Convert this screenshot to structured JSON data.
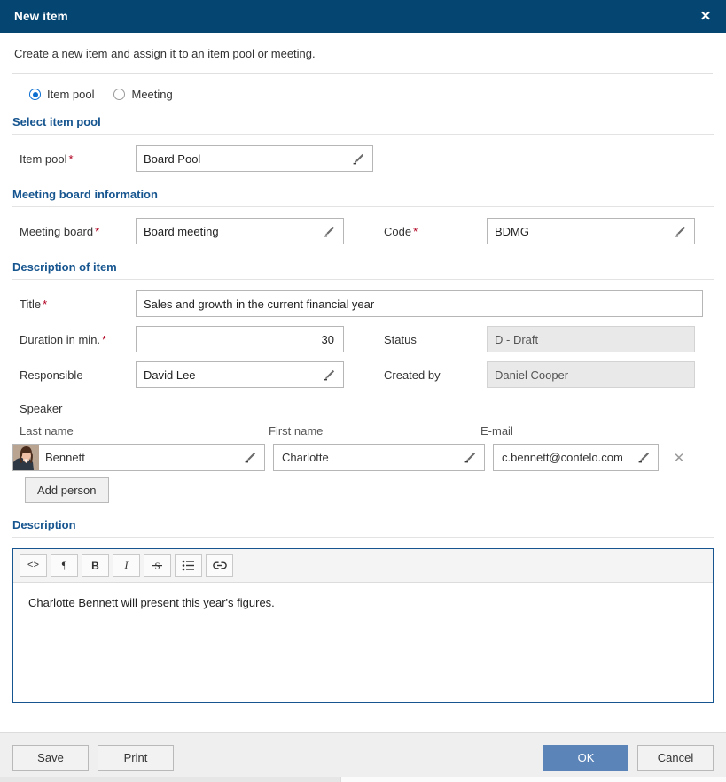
{
  "titlebar": {
    "title": "New item",
    "close_icon": "close-icon",
    "close_glyph": "✕",
    "background": "#054571"
  },
  "subtitle": "Create a new item and assign it to an item pool or meeting.",
  "assignment": {
    "options": [
      {
        "label": "Item pool",
        "selected": true
      },
      {
        "label": "Meeting",
        "selected": false
      }
    ],
    "accent": "#0a6ed1"
  },
  "sections": {
    "select_item_pool": {
      "heading": "Select item pool",
      "fields": {
        "item_pool": {
          "label": "Item pool",
          "required_marker": "*",
          "value": "Board Pool",
          "icon": "pencil-icon"
        }
      }
    },
    "meeting_board_information": {
      "heading": "Meeting board information",
      "fields": {
        "meeting_board": {
          "label": "Meeting board",
          "required_marker": "*",
          "value": "Board meeting",
          "icon": "pencil-icon"
        },
        "code": {
          "label": "Code",
          "required_marker": "*",
          "value": "BDMG",
          "icon": "pencil-icon"
        }
      }
    },
    "description_of_item": {
      "heading": "Description of item",
      "fields": {
        "title": {
          "label": "Title",
          "required_marker": "*",
          "value": "Sales and growth in the current financial year"
        },
        "duration": {
          "label": "Duration in min.",
          "required_marker": "*",
          "value": "30"
        },
        "status": {
          "label": "Status",
          "value": "D - Draft",
          "readonly": true
        },
        "responsible": {
          "label": "Responsible",
          "value": "David Lee",
          "icon": "pencil-icon"
        },
        "created_by": {
          "label": "Created by",
          "value": "Daniel Cooper",
          "readonly": true
        }
      }
    },
    "speaker": {
      "heading": "Speaker",
      "columns": {
        "last_name": "Last name",
        "first_name": "First name",
        "email": "E-mail"
      },
      "rows": [
        {
          "avatar": "person-photo-avatar",
          "last_name": "Bennett",
          "first_name": "Charlotte",
          "email": "c.bennett@contelo.com",
          "delete_glyph": "✕"
        }
      ],
      "add_person_label": "Add person"
    },
    "description": {
      "heading": "Description",
      "toolbar": [
        {
          "name": "source-code-icon",
          "glyph": "<>",
          "title": "Source code"
        },
        {
          "name": "paragraph-icon",
          "glyph": "¶",
          "title": "Paragraph"
        },
        {
          "name": "bold-icon",
          "glyph": "B",
          "title": "Bold"
        },
        {
          "name": "italic-icon",
          "glyph": "I",
          "title": "Italic"
        },
        {
          "name": "strikethrough-icon",
          "glyph": "S",
          "title": "Strikethrough"
        },
        {
          "name": "bullet-list-icon",
          "glyph": "",
          "title": "Bulleted list"
        },
        {
          "name": "link-icon",
          "glyph": "",
          "title": "Link"
        }
      ],
      "content": "Charlotte Bennett will present this year's figures."
    }
  },
  "footer": {
    "save_label": "Save",
    "print_label": "Print",
    "ok_label": "OK",
    "cancel_label": "Cancel",
    "primary_color": "#5b84b9"
  }
}
